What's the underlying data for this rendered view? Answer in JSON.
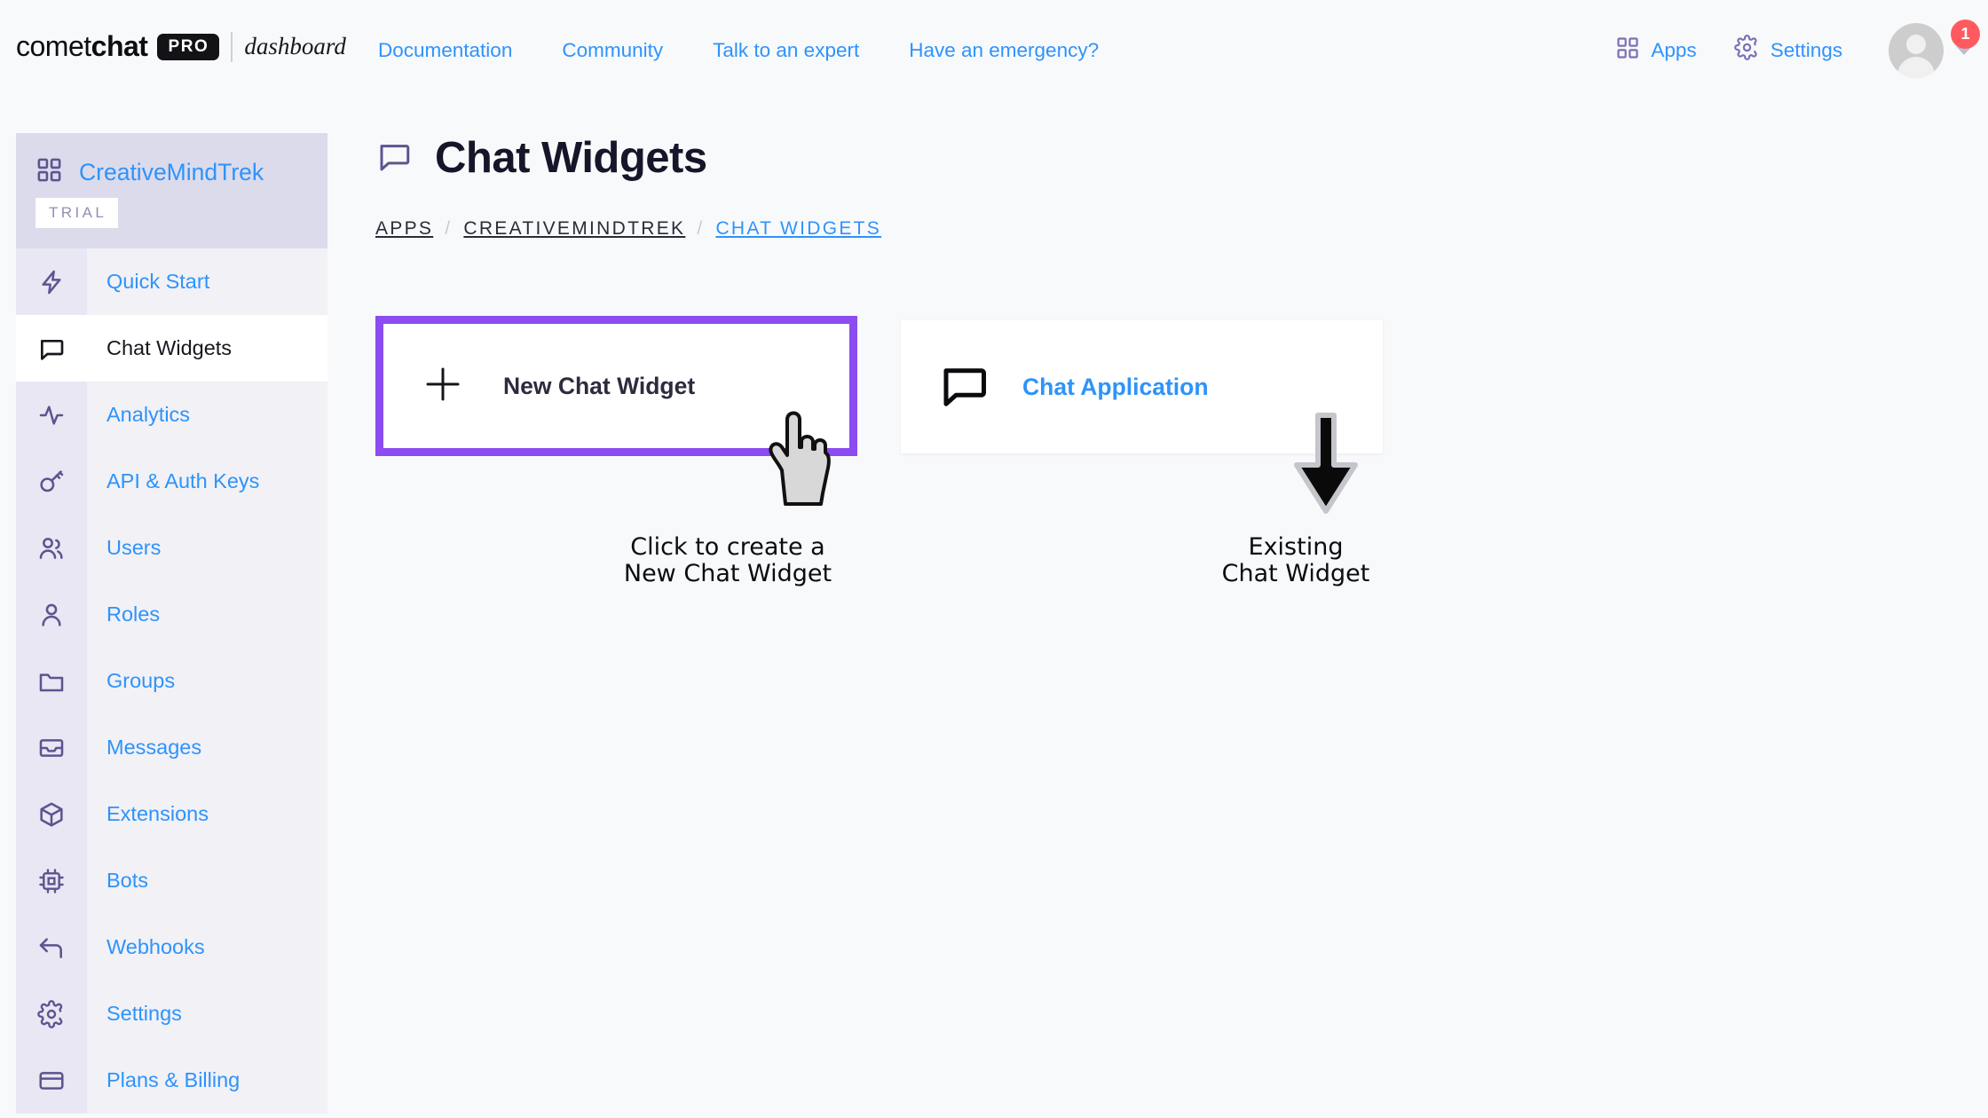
{
  "brand": {
    "name_light": "comet",
    "name_bold": "chat",
    "pro_badge": "PRO",
    "dashboard": "dashboard"
  },
  "topnav": {
    "links": [
      {
        "label": "Documentation"
      },
      {
        "label": "Community"
      },
      {
        "label": "Talk to an expert"
      },
      {
        "label": "Have an emergency?"
      }
    ]
  },
  "topright": {
    "apps_label": "Apps",
    "apps_icon": "grid-icon",
    "settings_label": "Settings",
    "settings_icon": "gear-icon",
    "avatar_icon": "avatar",
    "notification_count": "1",
    "caret_icon": "chevron-down-icon"
  },
  "sidebar": {
    "app_name": "CreativeMindTrek",
    "app_icon": "grid-icon",
    "plan_badge": "TRIAL",
    "items": [
      {
        "label": "Quick Start",
        "icon": "bolt-icon",
        "active": false
      },
      {
        "label": "Chat Widgets",
        "icon": "chat-bubble-icon",
        "active": true
      },
      {
        "label": "Analytics",
        "icon": "activity-icon",
        "active": false
      },
      {
        "label": "API & Auth Keys",
        "icon": "key-icon",
        "active": false
      },
      {
        "label": "Users",
        "icon": "users-icon",
        "active": false
      },
      {
        "label": "Roles",
        "icon": "user-icon",
        "active": false
      },
      {
        "label": "Groups",
        "icon": "folder-icon",
        "active": false
      },
      {
        "label": "Messages",
        "icon": "inbox-icon",
        "active": false
      },
      {
        "label": "Extensions",
        "icon": "box-icon",
        "active": false
      },
      {
        "label": "Bots",
        "icon": "chip-icon",
        "active": false
      },
      {
        "label": "Webhooks",
        "icon": "arrow-return-icon",
        "active": false
      },
      {
        "label": "Settings",
        "icon": "gear-icon",
        "active": false
      },
      {
        "label": "Plans & Billing",
        "icon": "credit-card-icon",
        "active": false
      }
    ]
  },
  "page": {
    "title": "Chat Widgets",
    "title_icon": "chat-bubble-icon",
    "breadcrumb": [
      {
        "label": "APPS",
        "current": false
      },
      {
        "label": "CREATIVEMINDTREK",
        "current": false
      },
      {
        "label": "CHAT WIDGETS",
        "current": true
      }
    ]
  },
  "cards": {
    "new_widget": {
      "label": "New Chat Widget",
      "icon": "plus-icon",
      "highlight_color": "#8b4cf0"
    },
    "existing_widget": {
      "label": "Chat Application",
      "icon": "chat-bubble-icon",
      "label_color": "#2e93fb"
    }
  },
  "annotations": {
    "left": {
      "line1": "Click to create a",
      "line2": "New Chat Widget",
      "marker": "hand-cursor-icon"
    },
    "right": {
      "line1": "Existing",
      "line2": "Chat Widget",
      "marker": "down-arrow-icon"
    }
  },
  "colors": {
    "accent_blue": "#2e93fb",
    "highlight_purple": "#8b4cf0",
    "badge_red": "#ff5a5f",
    "sidebar_header": "#dcdbec",
    "page_bg": "#f8f9fb"
  }
}
